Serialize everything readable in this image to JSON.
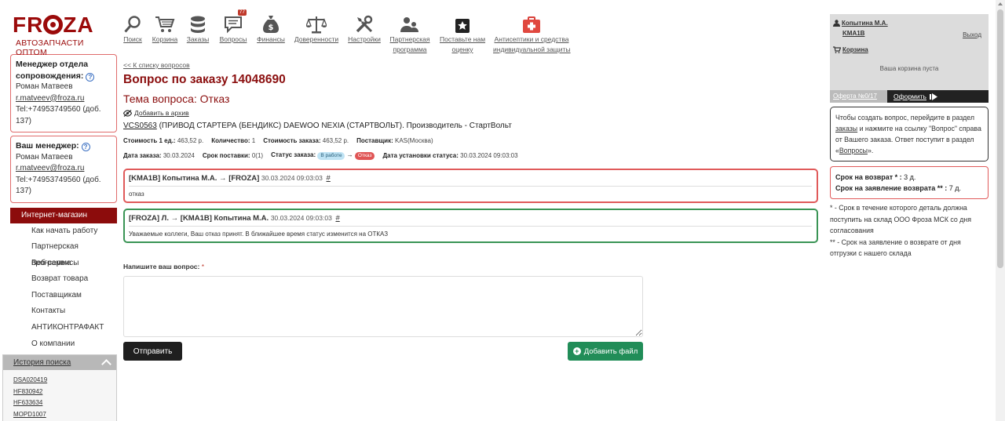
{
  "logo": {
    "brand_pre": "FR",
    "brand_post": "ZA",
    "subtitle": "АВТОЗАПЧАСТИ ОПТОМ"
  },
  "toolbar": [
    {
      "label": "Поиск",
      "icon": "search-icon"
    },
    {
      "label": "Корзина",
      "icon": "cart-icon"
    },
    {
      "label": "Заказы",
      "icon": "database-icon"
    },
    {
      "label": "Вопросы",
      "icon": "chat-icon",
      "badge": "77"
    },
    {
      "label": "Финансы",
      "icon": "money-bag-icon"
    },
    {
      "label": "Доверенности",
      "icon": "scales-icon"
    },
    {
      "label": "Настройки",
      "icon": "tools-icon"
    },
    {
      "label_line1": "Партнерская",
      "label_line2": "программа",
      "icon": "users-icon"
    },
    {
      "label_line1": "Поставьте нам",
      "label_line2": "оценку",
      "icon": "star-icon"
    },
    {
      "label_line1": "Антисептики и средства",
      "label_line2": "индивидуальной защиты",
      "icon": "first-aid-icon"
    }
  ],
  "managers": [
    {
      "title": "Менеджер отдела сопровождения:",
      "name": "Роман Матвеев",
      "email": "r.matveev@froza.ru",
      "tel": "Tel:+74953749560 (доб. 137)"
    },
    {
      "title": "Ваш менеджер:",
      "name": "Роман Матвеев",
      "email": "r.matveev@froza.ru",
      "tel": "Tel:+74953749560 (доб. 137)"
    }
  ],
  "nav": {
    "head": "Интернет-магазин",
    "items": [
      "Как начать работу",
      "Партнерская программа",
      "Веб-сервисы",
      "Возврат товара",
      "Поставщикам",
      "Контакты",
      "АНТИКОНТРАФАКТ",
      "О компании"
    ]
  },
  "history": {
    "title": "История поиска",
    "items": [
      "DSA020419",
      "HF830942",
      "HF633634",
      "MOPD1007"
    ]
  },
  "main": {
    "back": "<< К списку вопросов",
    "title": "Вопрос по заказу 14048690",
    "topic": "Тема вопроса: Отказ",
    "archive": "Добавить в архив",
    "product_code": "VCS0563",
    "product_desc": " (ПРИВОД СТАРТЕРА (БЕНДИКС) DAEWOO NEXIA (СТАРТВОЛЬТ). Производитель - СтартВольт",
    "props1": [
      {
        "k": "Стоимость 1 ед.:",
        "v": "463,52 р."
      },
      {
        "k": "Количество:",
        "v": "1"
      },
      {
        "k": "Стоимость заказа:",
        "v": "463,52 р."
      },
      {
        "k": "Поставщик:",
        "v": "KAS(Москва)"
      }
    ],
    "date_label": "Дата заказа:",
    "date_value": "30.03.2024",
    "term_label": "Срок поставки:",
    "term_value": "0(1)",
    "status_label": "Статус заказа:",
    "status_from": "В работе",
    "status_to": "Отказ",
    "set_label": "Дата установки статуса:",
    "set_value": "30.03.2024 09:03:03",
    "messages": [
      {
        "from": "[KMA1B] Копытина М.А.",
        "to": "[FROZA]",
        "date": "30.03.2024 09:03:03",
        "hash": "#",
        "body": "отказ"
      },
      {
        "from": "[FROZA] Л.",
        "to": "[KMA1B] Копытина М.А.",
        "date": "30.03.2024 09:03:03",
        "hash": "#",
        "body": "Уважаемые коллеги, Ваш отказ принят. В ближайшее время статус изменится на ОТКАЗ"
      }
    ],
    "question_label": "Напишите ваш вопрос:",
    "required_mark": "*",
    "send": "Отправить",
    "add_file": "Добавить файл"
  },
  "right": {
    "user": "Копытина М.А.",
    "login": "KMA1B",
    "exit": "Выход",
    "cart": "Корзина",
    "cart_empty": "Ваша корзина пуста",
    "offer": "Оферта №0/17",
    "order": "Оформить",
    "info_p1": "Чтобы создать вопрос, перейдите в раздел ",
    "info_link1": "заказы",
    "info_p2": " и нажмите на ссылку \"Вопрос\" справа от Вашего заказа. Ответ поступит в раздел «",
    "info_link2": "Вопросы",
    "info_p3": "».",
    "return_label": "Срок на возврат * :",
    "return_value": "3 д.",
    "claim_label": "Срок на заявление возврата ** :",
    "claim_value": "7 д.",
    "note1": "* - Срок в течение которого деталь должна поступить на склад ООО Фроза МСК со дня согласования",
    "note2": "** - Срок на заявление о возврате от дня отгрузки с нашего склада"
  }
}
